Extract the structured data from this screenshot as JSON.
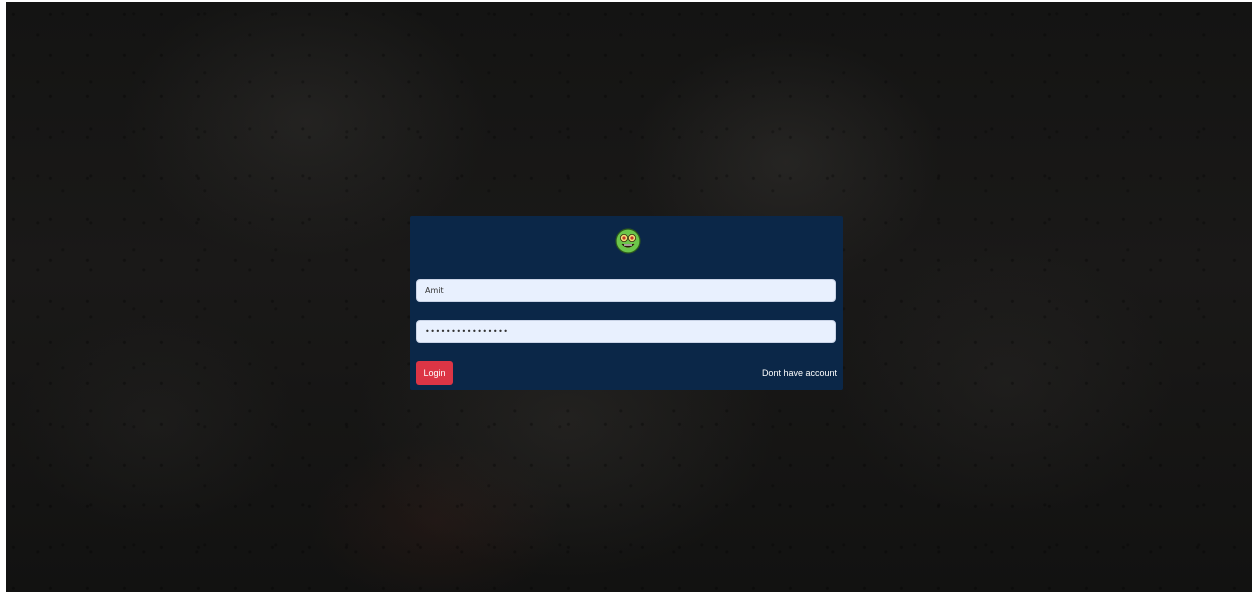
{
  "login_form": {
    "logo_icon": "green-smiley-face-icon",
    "username": {
      "value": "Amit",
      "placeholder": ""
    },
    "password": {
      "value": "••••••••••••••••",
      "placeholder": ""
    },
    "login_button_label": "Login",
    "signup_link_label": "Dont have account"
  },
  "colors": {
    "card_background": "#0b2748",
    "login_button": "#dc3545",
    "input_background": "#e8f0fe",
    "logo_green": "#6cc64a"
  }
}
